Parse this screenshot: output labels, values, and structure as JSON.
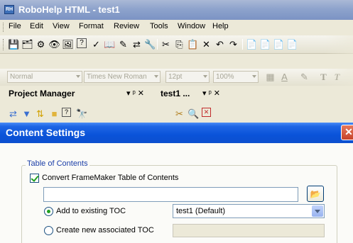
{
  "window": {
    "app_icon": "RH",
    "title": "RoboHelp HTML - test1"
  },
  "menu": [
    "File",
    "Edit",
    "View",
    "Format",
    "Review",
    "Tools",
    "Window",
    "Help"
  ],
  "toolbar1_icons": [
    {
      "name": "save-icon",
      "glyph": "💾"
    },
    {
      "name": "save-all-icon",
      "glyph": "🗂"
    },
    {
      "name": "compile-icon",
      "glyph": "⚙"
    },
    {
      "name": "view-icon",
      "glyph": "👁"
    },
    {
      "name": "preview-icon",
      "glyph": "🖼"
    },
    {
      "name": "help-icon",
      "glyph": "?"
    },
    {
      "name": "spellcheck-icon",
      "glyph": "✓"
    },
    {
      "name": "thesaurus-icon",
      "glyph": "📖"
    },
    {
      "name": "edit-icon",
      "glyph": "✎"
    },
    {
      "name": "find-replace-icon",
      "glyph": "⇄"
    },
    {
      "name": "properties-icon",
      "glyph": "🔧"
    },
    {
      "name": "cut-icon",
      "glyph": "✂"
    },
    {
      "name": "copy-icon",
      "glyph": "⎘"
    },
    {
      "name": "paste-icon",
      "glyph": "📋"
    },
    {
      "name": "delete-icon",
      "glyph": "✕"
    },
    {
      "name": "undo-icon",
      "glyph": "↶"
    },
    {
      "name": "redo-icon",
      "glyph": "↷"
    },
    {
      "name": "new-topic-icon",
      "glyph": "📄"
    },
    {
      "name": "new-folder-icon",
      "glyph": "📄"
    },
    {
      "name": "new-link-icon",
      "glyph": "📄"
    },
    {
      "name": "new-index-icon",
      "glyph": "📄"
    }
  ],
  "format_toolbar": {
    "style": "Normal",
    "font": "Times New Roman",
    "size": "12pt",
    "zoom": "100%",
    "bold_label": "T",
    "italic_label": "T"
  },
  "panes": {
    "left_title": "Project Manager",
    "left_ctrl": "▾ ᵖ ✕",
    "right_title": "test1 ...",
    "right_ctrl": "▾ ᵖ ✕"
  },
  "dialog": {
    "title": "Content Settings",
    "close_label": "✕",
    "group_label": "Table of Contents",
    "checkbox_label": "Convert FrameMaker Table of Contents",
    "checkbox_checked": true,
    "path_value": "",
    "radio_add_label": "Add to existing TOC",
    "radio_create_label": "Create new associated  TOC",
    "selected_toc": "test1 (Default)",
    "new_toc_value": ""
  }
}
